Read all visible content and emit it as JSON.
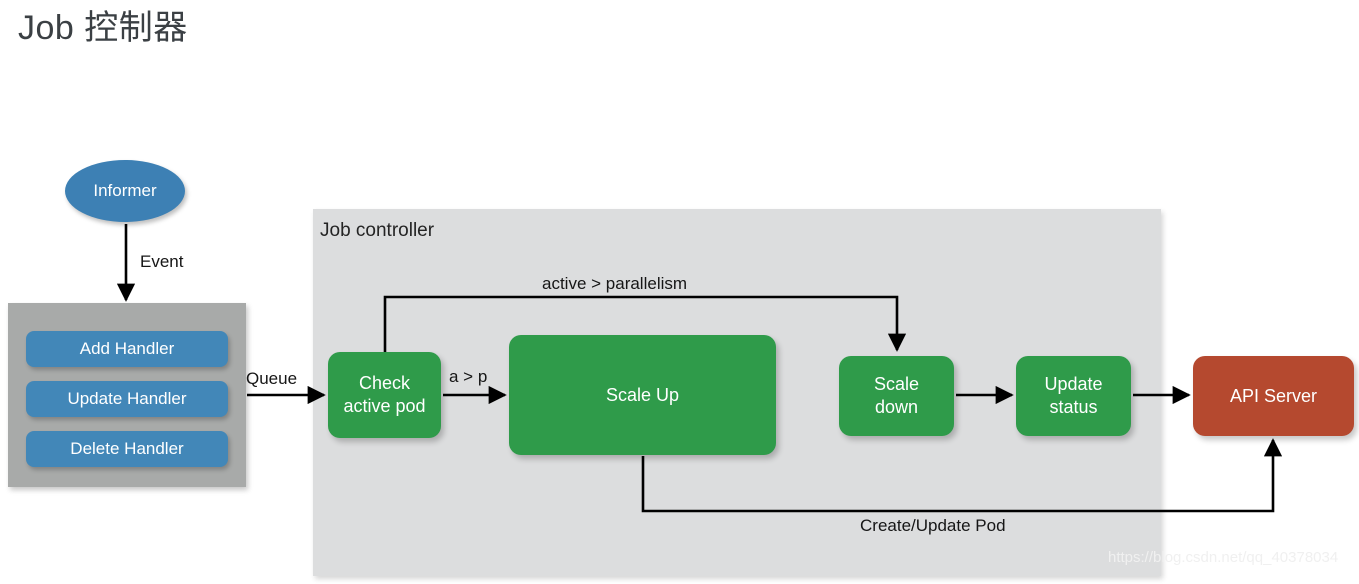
{
  "page": {
    "title": "Job 控制器",
    "watermark": "https://blog.csdn.net/qq_40378034",
    "background_color": "#ffffff"
  },
  "colors": {
    "blue": "#3d80b4",
    "green": "#2f9b4a",
    "red": "#b5492f",
    "panel_gray": "#dcddde",
    "handler_gray": "#a8aaa9",
    "line": "#000000",
    "title_text": "#3b4044"
  },
  "diagram": {
    "type": "flowchart",
    "informer": {
      "label": "Informer",
      "shape": "ellipse",
      "color": "#3d80b4"
    },
    "handler_group": {
      "shape": "rectangle",
      "color": "#a8aaa9",
      "handlers": [
        {
          "label": "Add Handler"
        },
        {
          "label": "Update Handler"
        },
        {
          "label": "Delete Handler"
        }
      ]
    },
    "job_controller": {
      "label": "Job controller",
      "color": "#dcddde",
      "nodes": [
        {
          "id": "check",
          "label": "Check\nactive pod",
          "line1": "Check",
          "line2": "active pod",
          "color": "#2f9b4a"
        },
        {
          "id": "scaleup",
          "label": "Scale Up",
          "line1": "Scale Up",
          "line2": "",
          "color": "#2f9b4a"
        },
        {
          "id": "scaledown",
          "label": "Scale\ndown",
          "line1": "Scale",
          "line2": "down",
          "color": "#2f9b4a"
        },
        {
          "id": "update",
          "label": "Update\nstatus",
          "line1": "Update",
          "line2": "status",
          "color": "#2f9b4a"
        }
      ]
    },
    "api_server": {
      "label": "API Server",
      "color": "#b5492f"
    },
    "edges": [
      {
        "id": "informer-to-handlers",
        "from": "informer",
        "to": "handler_group",
        "label": "Event"
      },
      {
        "id": "handlers-to-check",
        "from": "handler_group",
        "to": "check",
        "label": "Queue"
      },
      {
        "id": "check-to-scaleup",
        "from": "check",
        "to": "scaleup",
        "label": "a > p"
      },
      {
        "id": "check-to-scaledown",
        "from": "check",
        "to": "scaledown",
        "label": "active > parallelism"
      },
      {
        "id": "scaledown-to-update",
        "from": "scaledown",
        "to": "update",
        "label": ""
      },
      {
        "id": "update-to-apiserver",
        "from": "update",
        "to": "api_server",
        "label": ""
      },
      {
        "id": "scaleup-to-apiserver",
        "from": "scaleup",
        "to": "api_server",
        "label": "Create/Update  Pod"
      }
    ]
  }
}
